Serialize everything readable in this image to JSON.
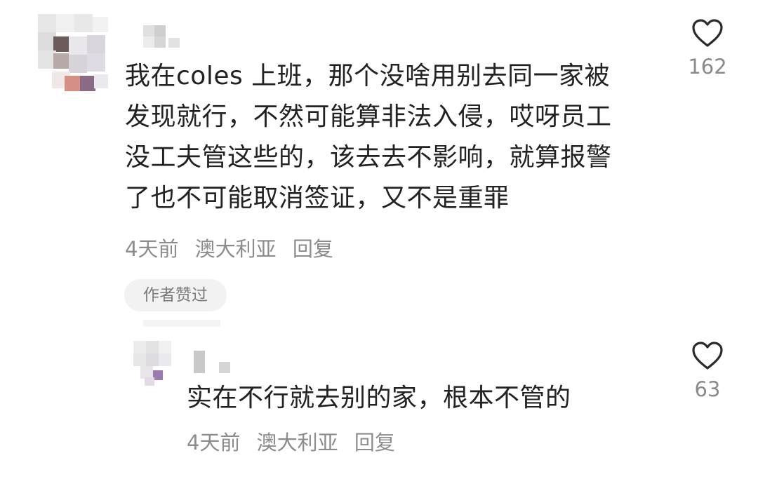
{
  "comments": [
    {
      "text": "我在coles 上班，那个没啥用别去同一家被\n发现就行，不然可能算非法入侵，哎呀员工\n没工夫管这些的，该去去不影响，就算报警\n了也不可能取消签证，又不是重罪",
      "time": "4天前",
      "location": "澳大利亚",
      "reply_label": "回复",
      "badge": "作者赞过",
      "like_icon": "heart-outline-icon",
      "likes": "162"
    },
    {
      "text": "实在不行就去别的家，根本不管的",
      "time": "4天前",
      "location": "澳大利亚",
      "reply_label": "回复",
      "like_icon": "heart-outline-icon",
      "likes": "63"
    }
  ]
}
